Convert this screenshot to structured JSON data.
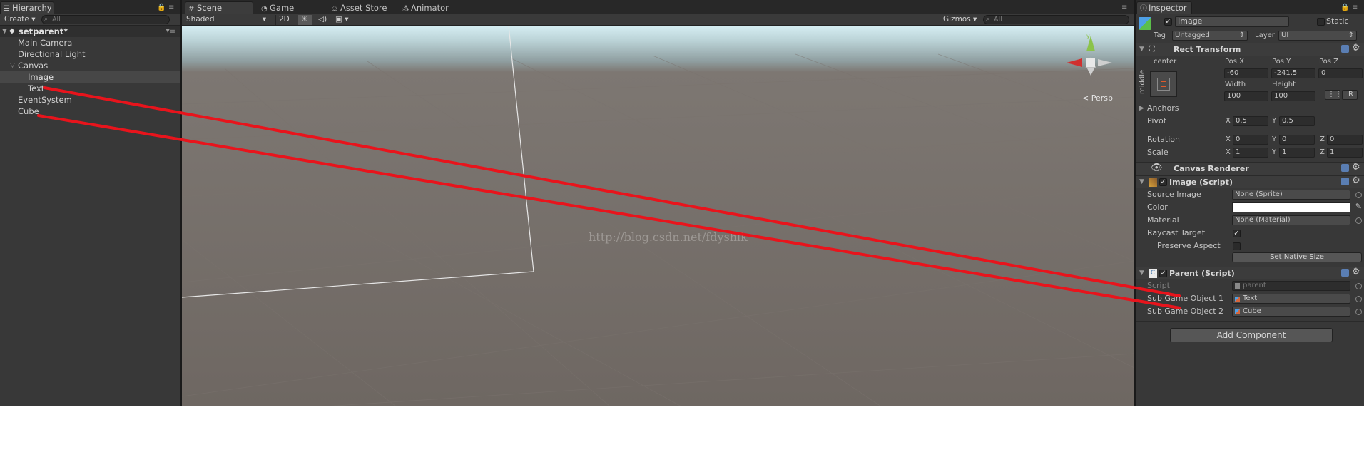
{
  "hierarchy": {
    "tab": "Hierarchy",
    "create": "Create",
    "search_placeholder": "All",
    "scene_name": "setparent*",
    "items": [
      {
        "label": "Main Camera"
      },
      {
        "label": "Directional Light"
      },
      {
        "label": "Canvas"
      },
      {
        "label": "Image"
      },
      {
        "label": "Text"
      },
      {
        "label": "EventSystem"
      },
      {
        "label": "Cube"
      }
    ]
  },
  "scene": {
    "tabs": [
      {
        "label": "Scene"
      },
      {
        "label": "Game"
      },
      {
        "label": "Asset Store"
      },
      {
        "label": "Animator"
      }
    ],
    "shading": "Shaded",
    "mode_2d": "2D",
    "gizmos": "Gizmos",
    "search_placeholder": "All",
    "persp_label": "Persp",
    "watermark": "http://blog.csdn.net/fdyshlk",
    "gizmo_axis_y": "y"
  },
  "inspector": {
    "tab": "Inspector",
    "object_name": "Image",
    "static_label": "Static",
    "tag_label": "Tag",
    "tag_value": "Untagged",
    "layer_label": "Layer",
    "layer_value": "UI",
    "rect_transform": {
      "title": "Rect Transform",
      "anchor_h": "center",
      "anchor_v": "middle",
      "pos_x_label": "Pos X",
      "pos_y_label": "Pos Y",
      "pos_z_label": "Pos Z",
      "pos_x": "-60",
      "pos_y": "-241.5",
      "pos_z": "0",
      "width_label": "Width",
      "height_label": "Height",
      "width": "100",
      "height": "100",
      "raw_btn": "R",
      "anchors_label": "Anchors",
      "pivot_label": "Pivot",
      "pivot_x": "0.5",
      "pivot_y": "0.5",
      "rotation_label": "Rotation",
      "rot_x": "0",
      "rot_y": "0",
      "rot_z": "0",
      "scale_label": "Scale",
      "scale_x": "1",
      "scale_y": "1",
      "scale_z": "1",
      "x": "X",
      "y": "Y",
      "z": "Z"
    },
    "canvas_renderer": {
      "title": "Canvas Renderer"
    },
    "image_script": {
      "title": "Image (Script)",
      "source_image_label": "Source Image",
      "source_image": "None (Sprite)",
      "color_label": "Color",
      "material_label": "Material",
      "material": "None (Material)",
      "raycast_label": "Raycast Target",
      "preserve_label": "Preserve Aspect",
      "native_size": "Set Native Size"
    },
    "parent_script": {
      "title": "Parent (Script)",
      "script_label": "Script",
      "script_value": "parent",
      "sub1_label": "Sub Game Object 1",
      "sub1_value": "Text",
      "sub2_label": "Sub Game Object 2",
      "sub2_value": "Cube"
    },
    "add_component": "Add Component"
  },
  "colors": {
    "annotation": "#e8141c",
    "panel": "#383838",
    "ground": "#6e6762"
  }
}
